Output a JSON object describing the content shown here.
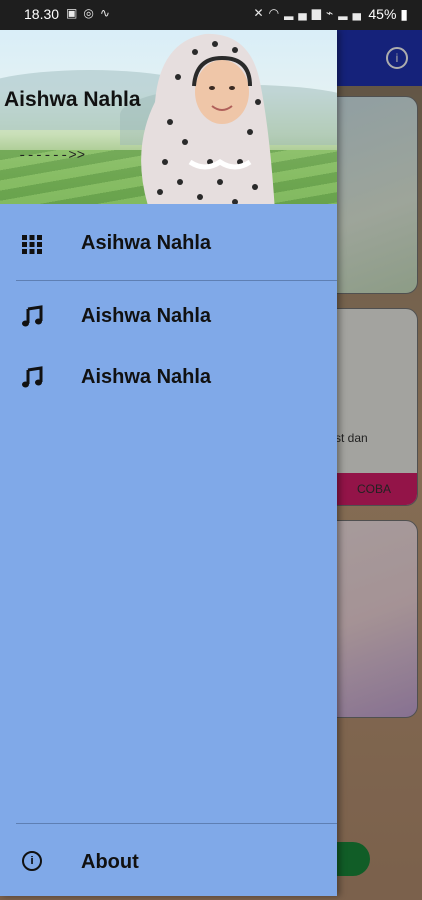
{
  "status_bar": {
    "time": "18.30",
    "left_icons": [
      "gallery-icon",
      "whatsapp-icon",
      "wifi-call-icon"
    ],
    "right_icons": [
      "mute-icon",
      "wifi-icon",
      "signal-icon",
      "volte-icon",
      "signal-icon-2"
    ],
    "battery": "45%"
  },
  "background_app": {
    "card_text": "st dan",
    "card_button": "COBA"
  },
  "drawer": {
    "header_title": "Aishwa Nahla",
    "header_subtitle": "------>>",
    "items": [
      {
        "label": "Asihwa Nahla",
        "icon": "grid-icon"
      },
      {
        "label": "Aishwa Nahla",
        "icon": "music-note-icon"
      },
      {
        "label": "Aishwa Nahla",
        "icon": "music-note-icon"
      }
    ],
    "about": {
      "label": "About",
      "icon": "info-icon"
    }
  },
  "colors": {
    "drawer_bg": "#80a9e8",
    "appbar_bg": "#1f33b4",
    "accent_button": "#d91e6b",
    "status_bar_bg": "#1e1e1e"
  }
}
